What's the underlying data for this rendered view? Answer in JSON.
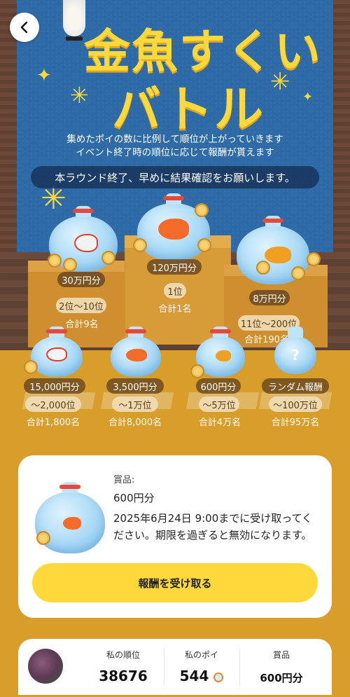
{
  "header": {
    "back_label": "Back",
    "title_line1": "金魚すくい",
    "title_line2": "バトル"
  },
  "intro": {
    "line1": "集めたポイの数に比例して順位が上がっていきます",
    "line2": "イベント終了時の順位に応じて報酬が貰えます",
    "notice": "本ラウンド終了、早めに結果確認をお願いします。"
  },
  "podium": {
    "first": {
      "reward": "120万円分",
      "rank": "1位",
      "total": "合計1名"
    },
    "second": {
      "reward": "30万円分",
      "rank": "2位〜10位",
      "total": "合計9名"
    },
    "third": {
      "reward": "8万円分",
      "rank": "11位〜200位",
      "total": "合計190名"
    }
  },
  "lower_prizes": [
    {
      "reward": "15,000円分",
      "rank": "〜2,000位",
      "total": "合計1,800名"
    },
    {
      "reward": "3,500円分",
      "rank": "〜1万位",
      "total": "合計8,000名"
    },
    {
      "reward": "600円分",
      "rank": "〜5万位",
      "total": "合計4万名"
    },
    {
      "reward": "ランダム報酬",
      "rank": "〜100万位",
      "total": "合計95万名"
    }
  ],
  "prize_card": {
    "label": "賞品:",
    "value": "600円分",
    "deadline_text": "2025年6月24日 9:00までに受け取ってください。期限を過ぎると無効になります。",
    "claim_button": "報酬を受け取る"
  },
  "stats": {
    "rank_label": "私の順位",
    "rank_value": "38676",
    "poi_label": "私のポイ",
    "poi_value": "544",
    "prize_label": "賞品",
    "prize_value": "600円分"
  },
  "colors": {
    "banner_blue": "#2d6aa6",
    "title_yellow": "#ffd93b",
    "background_gold": "#d99d2a",
    "button_yellow": "#ffd93b"
  }
}
